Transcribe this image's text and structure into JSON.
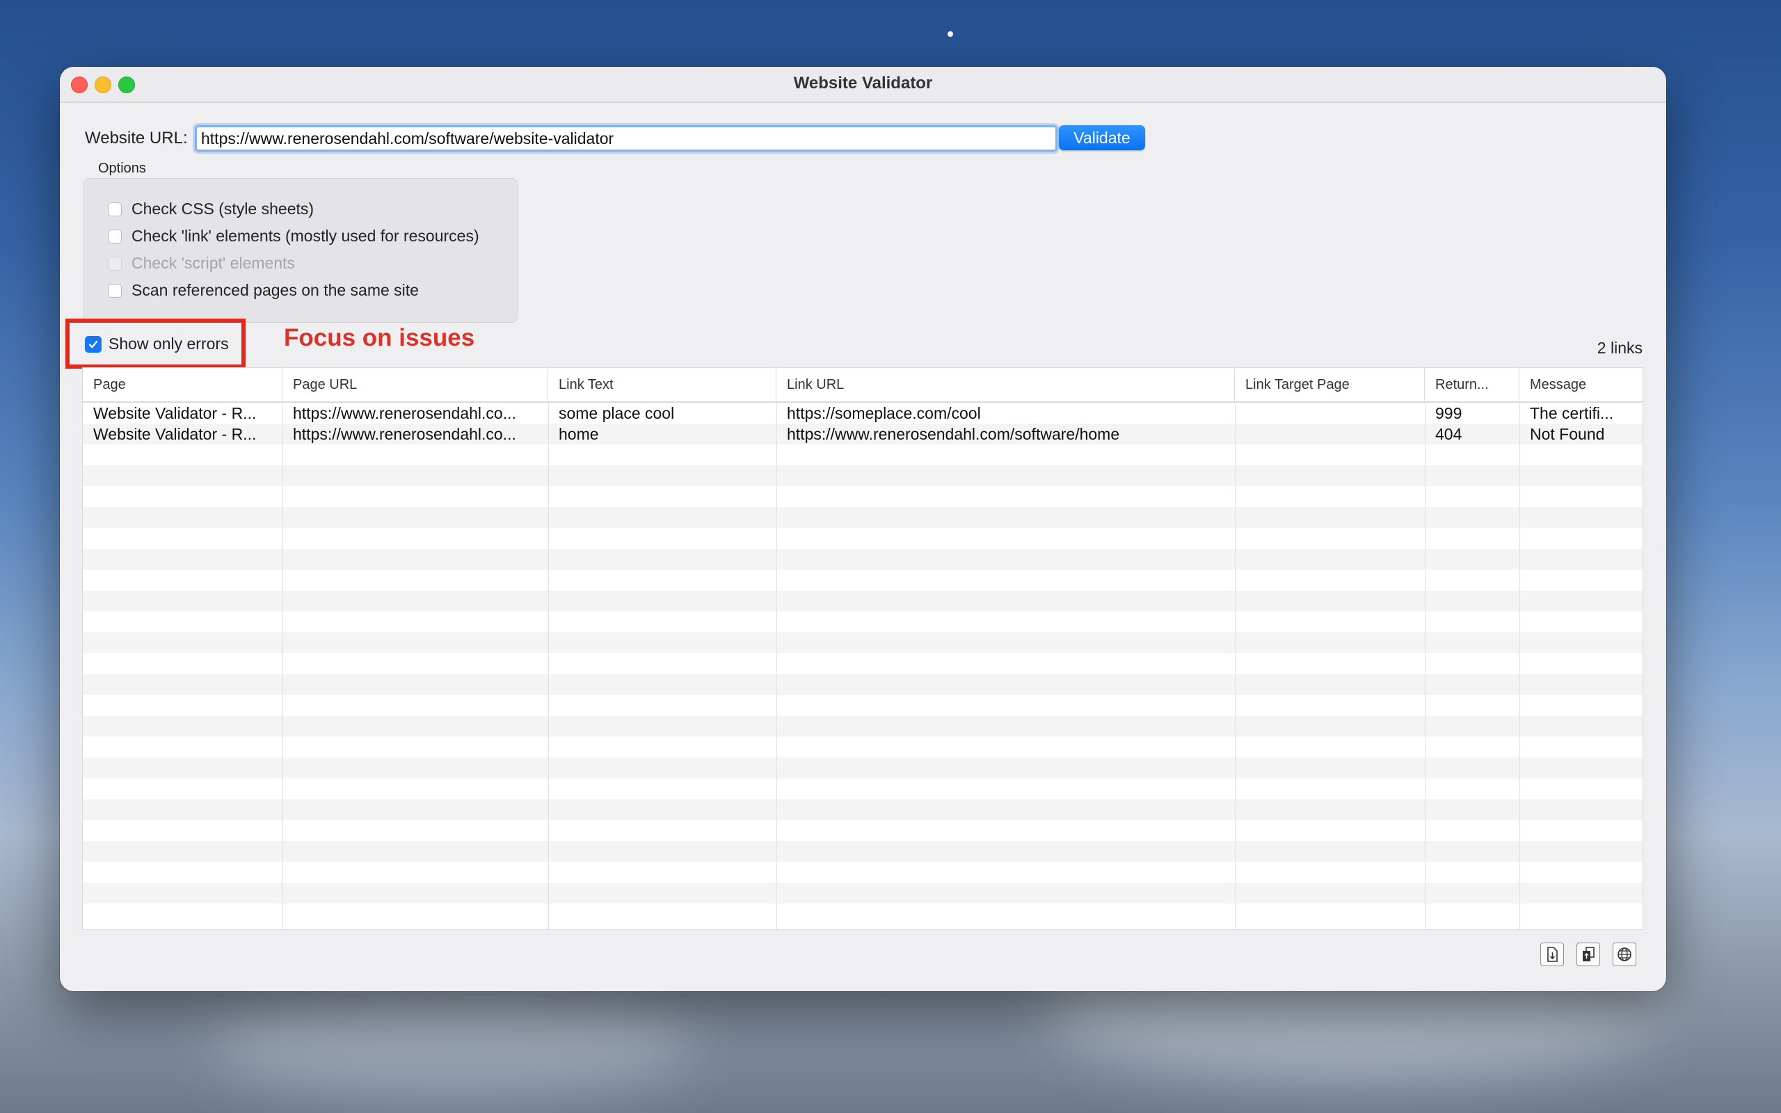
{
  "window": {
    "title": "Website Validator"
  },
  "form": {
    "url_label": "Website URL:",
    "url_value": "https://www.renerosendahl.com/software/website-validator",
    "validate_label": "Validate"
  },
  "options": {
    "label": "Options",
    "items": [
      {
        "label": "Check CSS (style sheets)",
        "checked": false,
        "disabled": false
      },
      {
        "label": "Check 'link' elements (mostly used for resources)",
        "checked": false,
        "disabled": false
      },
      {
        "label": "Check 'script' elements",
        "checked": false,
        "disabled": true
      },
      {
        "label": "Scan referenced pages on the same site",
        "checked": false,
        "disabled": false
      }
    ]
  },
  "filter": {
    "show_only_errors_label": "Show only errors",
    "checked": true
  },
  "annotation": {
    "text": "Focus on issues",
    "color": "#d8352a"
  },
  "results": {
    "count_label": "2 links",
    "columns": [
      "Page",
      "Page URL",
      "Link Text",
      "Link URL",
      "Link Target Page",
      "Return...",
      "Message"
    ],
    "rows": [
      [
        "Website Validator - R...",
        "https://www.renerosendahl.co...",
        "some place cool",
        "https://someplace.com/cool",
        "",
        "999",
        "The certifi..."
      ],
      [
        "Website Validator - R...",
        "https://www.renerosendahl.co...",
        "home",
        "https://www.renerosendahl.com/software/home",
        "",
        "404",
        "Not Found"
      ]
    ]
  },
  "toolbar": {
    "buttons": [
      {
        "icon": "export-document-icon"
      },
      {
        "icon": "copy-document-icon"
      },
      {
        "icon": "globe-icon"
      }
    ]
  },
  "colors": {
    "accent": "#1478f5",
    "highlight": "#e02a1e"
  }
}
